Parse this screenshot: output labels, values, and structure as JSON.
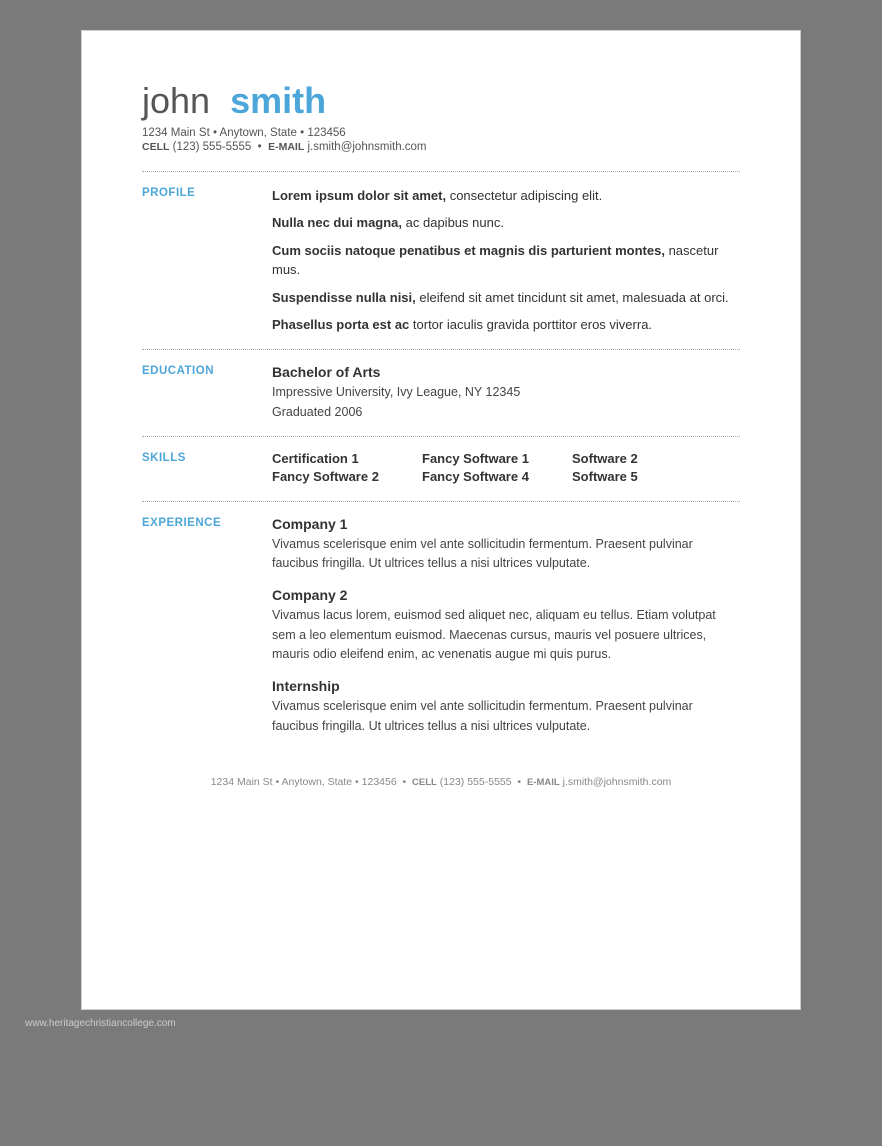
{
  "page": {
    "background_note": "www.heritagechristiancollege.com"
  },
  "header": {
    "first_name": "john",
    "last_name": "smith",
    "address": "1234 Main St • Anytown, State • 123456",
    "cell_label": "CELL",
    "cell_value": "(123) 555-5555",
    "email_label": "E-MAIL",
    "email_value": "j.smith@johnsmith.com"
  },
  "sections": {
    "profile": {
      "label": "PROFILE",
      "paragraphs": [
        {
          "bold": "Lorem ipsum dolor sit amet,",
          "rest": " consectetur adipiscing elit."
        },
        {
          "bold": "Nulla nec dui magna,",
          "rest": " ac dapibus nunc."
        },
        {
          "bold": "Cum sociis natoque penatibus et magnis dis parturient montes,",
          "rest": " nascetur mus."
        },
        {
          "bold": "Suspendisse nulla nisi,",
          "rest": " eleifend sit amet tincidunt sit amet, malesuada at orci."
        },
        {
          "bold": "Phasellus porta est ac",
          "rest": " tortor iaculis gravida porttitor eros viverra."
        }
      ]
    },
    "education": {
      "label": "EDUCATION",
      "degree": "Bachelor of Arts",
      "university": "Impressive University, Ivy League, NY 12345",
      "graduated": "Graduated 2006"
    },
    "skills": {
      "label": "SKILLS",
      "rows": [
        [
          "Certification 1",
          "Fancy Software 1",
          "Software 2"
        ],
        [
          "Fancy Software 2",
          "Fancy Software 4",
          "Software 5"
        ]
      ]
    },
    "experience": {
      "label": "EXPERIENCE",
      "entries": [
        {
          "company": "Company 1",
          "description": "Vivamus scelerisque enim vel ante sollicitudin fermentum. Praesent pulvinar faucibus fringilla. Ut ultrices tellus a nisi ultrices vulputate."
        },
        {
          "company": "Company 2",
          "description": "Vivamus lacus lorem, euismod sed aliquet nec, aliquam eu tellus. Etiam volutpat sem a leo elementum euismod. Maecenas cursus, mauris vel posuere ultrices, mauris odio eleifend enim, ac venenatis augue mi quis purus."
        },
        {
          "company": "Internship",
          "description": "Vivamus scelerisque enim vel ante sollicitudin fermentum. Praesent pulvinar faucibus fringilla. Ut ultrices tellus a nisi ultrices vulputate."
        }
      ]
    }
  },
  "footer": {
    "address": "1234 Main St • Anytown, State • 123456",
    "cell_label": "CELL",
    "cell_value": "(123) 555-5555",
    "email_label": "E-MAIL",
    "email_value": "j.smith@johnsmith.com"
  }
}
